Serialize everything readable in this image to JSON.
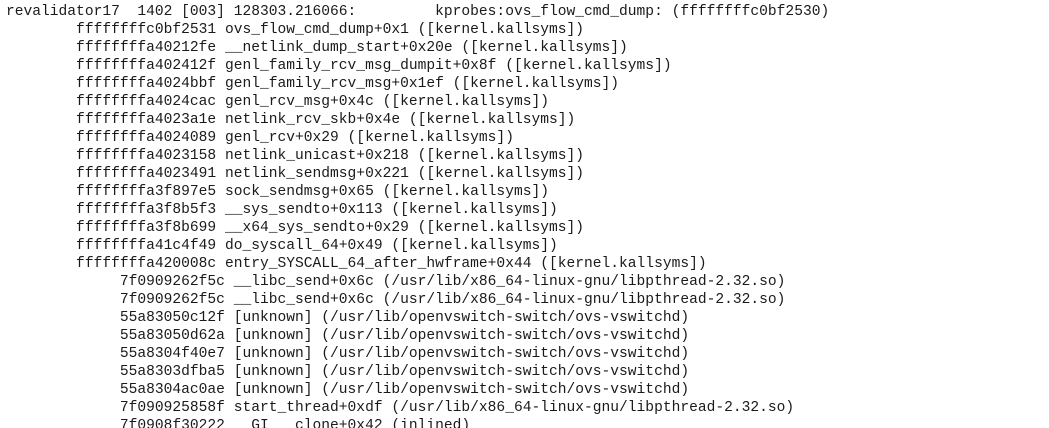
{
  "trace": {
    "lines": [
      "revalidator17  1402 [003] 128303.216066:         kprobes:ovs_flow_cmd_dump: (ffffffffc0bf2530)",
      "\tffffffffc0bf2531 ovs_flow_cmd_dump+0x1 ([kernel.kallsyms])",
      "\tffffffffa40212fe __netlink_dump_start+0x20e ([kernel.kallsyms])",
      "\tffffffffa402412f genl_family_rcv_msg_dumpit+0x8f ([kernel.kallsyms])",
      "\tffffffffa4024bbf genl_family_rcv_msg+0x1ef ([kernel.kallsyms])",
      "\tffffffffa4024cac genl_rcv_msg+0x4c ([kernel.kallsyms])",
      "\tffffffffa4023a1e netlink_rcv_skb+0x4e ([kernel.kallsyms])",
      "\tffffffffa4024089 genl_rcv+0x29 ([kernel.kallsyms])",
      "\tffffffffa4023158 netlink_unicast+0x218 ([kernel.kallsyms])",
      "\tffffffffa4023491 netlink_sendmsg+0x221 ([kernel.kallsyms])",
      "\tffffffffa3f897e5 sock_sendmsg+0x65 ([kernel.kallsyms])",
      "\tffffffffa3f8b5f3 __sys_sendto+0x113 ([kernel.kallsyms])",
      "\tffffffffa3f8b699 __x64_sys_sendto+0x29 ([kernel.kallsyms])",
      "\tffffffffa41c4f49 do_syscall_64+0x49 ([kernel.kallsyms])",
      "\tffffffffa420008c entry_SYSCALL_64_after_hwframe+0x44 ([kernel.kallsyms])",
      "\t     7f0909262f5c __libc_send+0x6c (/usr/lib/x86_64-linux-gnu/libpthread-2.32.so)",
      "\t     7f0909262f5c __libc_send+0x6c (/usr/lib/x86_64-linux-gnu/libpthread-2.32.so)",
      "\t     55a83050c12f [unknown] (/usr/lib/openvswitch-switch/ovs-vswitchd)",
      "\t     55a83050d62a [unknown] (/usr/lib/openvswitch-switch/ovs-vswitchd)",
      "\t     55a8304f40e7 [unknown] (/usr/lib/openvswitch-switch/ovs-vswitchd)",
      "\t     55a8303dfba5 [unknown] (/usr/lib/openvswitch-switch/ovs-vswitchd)",
      "\t     55a8304ac0ae [unknown] (/usr/lib/openvswitch-switch/ovs-vswitchd)",
      "\t     7f090925858f start_thread+0xdf (/usr/lib/x86_64-linux-gnu/libpthread-2.32.so)",
      "\t     7f0908f30222 __GI___clone+0x42 (inlined)"
    ]
  }
}
